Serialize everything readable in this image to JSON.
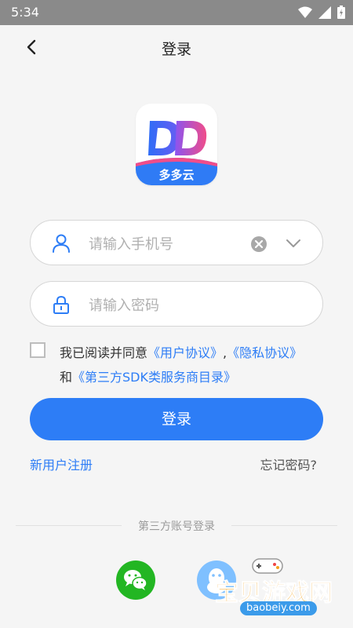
{
  "status_bar": {
    "time": "5:34"
  },
  "header": {
    "title": "登录"
  },
  "logo": {
    "text": "多多云"
  },
  "phone_field": {
    "placeholder": "请输入手机号"
  },
  "password_field": {
    "placeholder": "请输入密码"
  },
  "agreement": {
    "line1_prefix": "我已阅读并同意",
    "user_agreement": "《用户协议》",
    "separator": ",",
    "privacy_agreement": "《隐私协议》",
    "line2_prefix": "和",
    "sdk_list": "《第三方SDK类服务商目录》"
  },
  "login_button": "登录",
  "links": {
    "register": "新用户注册",
    "forgot": "忘记密码?"
  },
  "third_party": {
    "label": "第三方账号登录"
  },
  "watermark": {
    "main": "宝贝游戏网",
    "sub": "baobeiy.com"
  },
  "colors": {
    "accent": "#2d7df6",
    "wechat": "#23b623",
    "qq": "#7fc0ff"
  }
}
